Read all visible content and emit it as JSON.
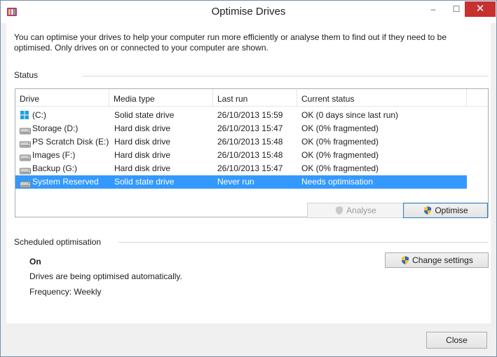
{
  "window": {
    "title": "Optimise Drives",
    "controls": {
      "minimize": "–",
      "maximize": "☐",
      "close": "✕"
    },
    "icon": "defrag-app-icon"
  },
  "intro_text": "You can optimise your drives to help your computer run more efficiently or analyse them to find out if they need to be optimised. Only drives on or connected to your computer are shown.",
  "status": {
    "label": "Status",
    "columns": [
      "Drive",
      "Media type",
      "Last run",
      "Current status"
    ],
    "rows": [
      {
        "icon": "windows-drive-icon",
        "drive": "(C:)",
        "media": "Solid state drive",
        "last_run": "26/10/2013 15:59",
        "status": "OK (0 days since last run)",
        "selected": false
      },
      {
        "icon": "hard-drive-icon",
        "drive": "Storage (D:)",
        "media": "Hard disk drive",
        "last_run": "26/10/2013 15:47",
        "status": "OK (0% fragmented)",
        "selected": false
      },
      {
        "icon": "hard-drive-icon",
        "drive": "PS Scratch Disk (E:)",
        "media": "Hard disk drive",
        "last_run": "26/10/2013 15:48",
        "status": "OK (0% fragmented)",
        "selected": false
      },
      {
        "icon": "hard-drive-icon",
        "drive": "Images (F:)",
        "media": "Hard disk drive",
        "last_run": "26/10/2013 15:48",
        "status": "OK (0% fragmented)",
        "selected": false
      },
      {
        "icon": "hard-drive-icon",
        "drive": "Backup (G:)",
        "media": "Hard disk drive",
        "last_run": "26/10/2013 15:47",
        "status": "OK (0% fragmented)",
        "selected": false
      },
      {
        "icon": "hard-drive-icon",
        "drive": "System Reserved",
        "media": "Solid state drive",
        "last_run": "Never run",
        "status": "Needs optimisation",
        "selected": true
      }
    ],
    "analyse_label": "Analyse",
    "optimise_label": "Optimise"
  },
  "scheduled": {
    "label": "Scheduled optimisation",
    "state": "On",
    "description": "Drives are being optimised automatically.",
    "frequency": "Frequency: Weekly",
    "change_settings_label": "Change settings"
  },
  "footer": {
    "close_label": "Close"
  },
  "colors": {
    "selection": "#3399ff",
    "close_button": "#c7312f",
    "window_bg": "#f0f0f0"
  }
}
